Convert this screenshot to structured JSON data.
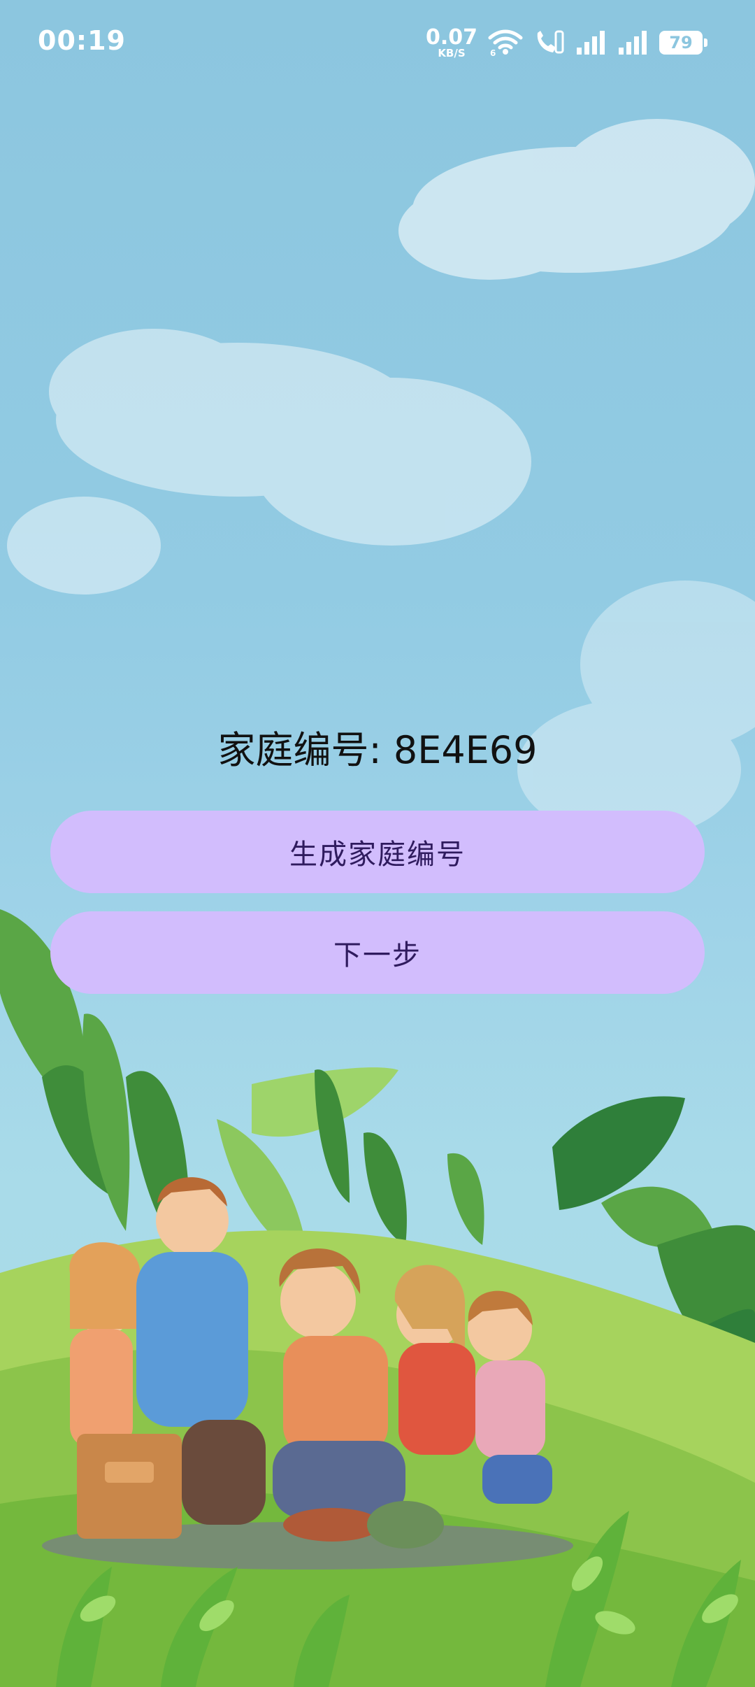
{
  "status_bar": {
    "time": "00:19",
    "net_speed_value": "0.07",
    "net_speed_unit": "KB/S",
    "wifi_label": "6",
    "battery_level": "79",
    "icons": [
      "wifi-icon",
      "hd-call-icon",
      "signal-icon",
      "signal-icon",
      "battery-icon"
    ]
  },
  "main": {
    "family_id_label": "家庭编号: 8E4E69",
    "generate_button_label": "生成家庭编号",
    "next_button_label": "下一步"
  },
  "colors": {
    "sky": "#8cc6df",
    "button_fill": "#d2bdfd",
    "button_text": "#2f1b5e",
    "grass": "#7fc24a"
  }
}
